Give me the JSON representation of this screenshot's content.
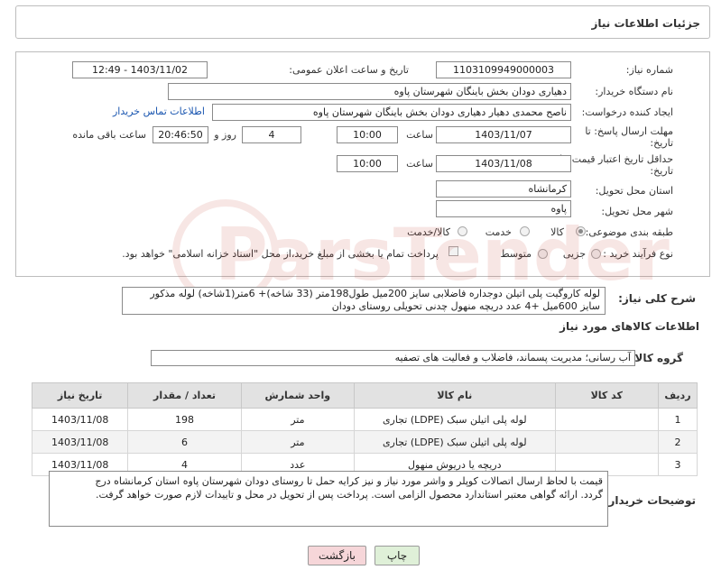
{
  "header": {
    "title": "جزئیات اطلاعات نیاز"
  },
  "form": {
    "need_number_label": "شماره نیاز:",
    "need_number": "1103109949000003",
    "announce_label": "تاریخ و ساعت اعلان عمومی:",
    "announce_value": "1403/11/02 - 12:49",
    "buyer_org_label": "نام دستگاه خریدار:",
    "buyer_org": "دهیاری دودان بخش باینگان شهرستان پاوه",
    "requester_label": "ایجاد کننده درخواست:",
    "requester": "ناصح محمدی دهیار دهیاری دودان بخش باینگان شهرستان پاوه",
    "contact_link": "اطلاعات تماس خریدار",
    "reply_deadline_label_1": "مهلت ارسال پاسخ: تا",
    "reply_deadline_label_2": "تاریخ:",
    "reply_date": "1403/11/07",
    "time_label": "ساعت",
    "reply_time": "10:00",
    "days_value": "4",
    "days_label": "روز و",
    "remaining_time": "20:46:50",
    "remaining_label": "ساعت باقی مانده",
    "price_validity_label_1": "حداقل تاریخ اعتبار قیمت: تا",
    "price_validity_label_2": "تاریخ:",
    "price_date": "1403/11/08",
    "price_time": "10:00",
    "province_label": "استان محل تحویل:",
    "province": "کرمانشاه",
    "city_label": "شهر محل تحویل:",
    "city": "پاوه",
    "category_label": "طبقه بندی موضوعی:",
    "category_options": [
      "کالا",
      "خدمت",
      "کالا/خدمت"
    ],
    "category_selected": 0,
    "process_label": "نوع فرآیند خرید :",
    "process_options": [
      "جزیی",
      "متوسط"
    ],
    "process_note": "پرداخت تمام یا بخشی از مبلغ خرید،از محل \"اسناد خزانه اسلامی\" خواهد بود."
  },
  "summary": {
    "label": "شرح کلی نیاز:",
    "text_line1": "لوله کاروگیت پلی اتیلن دوجداره فاضلابی سایز 200میل طول198متر (33 شاخه)+ 6متر(1شاخه) لوله مذکور",
    "text_line2": "سایز 600میل +4 عدد دریچه منهول چدنی تحویلی روستای دودان"
  },
  "goods": {
    "section_title": "اطلاعات کالاهای مورد نیاز",
    "group_label": "گروه کالا:",
    "group_value": "آب رسانی؛ مدیریت پسماند، فاضلاب و فعالیت های تصفیه",
    "columns": [
      "ردیف",
      "کد کالا",
      "نام کالا",
      "واحد شمارش",
      "تعداد / مقدار",
      "تاریخ نیاز"
    ],
    "rows": [
      {
        "row": "1",
        "code": "",
        "name": "لوله پلی اتیلن سبک (LDPE) تجاری",
        "unit": "متر",
        "qty": "198",
        "date": "1403/11/08"
      },
      {
        "row": "2",
        "code": "",
        "name": "لوله پلی اتیلن سبک (LDPE) تجاری",
        "unit": "متر",
        "qty": "6",
        "date": "1403/11/08"
      },
      {
        "row": "3",
        "code": "",
        "name": "دریچه یا دریوش منهول",
        "unit": "عدد",
        "qty": "4",
        "date": "1403/11/08"
      }
    ]
  },
  "buyer_notes": {
    "label": "توضیحات خریدار:",
    "line1": "قیمت با لحاظ ارسال اتصالات کوپلر و واشر مورد نیاز و نیز کرایه حمل تا روستای دودان شهرستان پاوه استان کرمانشاه درج",
    "line2": "گردد. ارائه گواهی معتبر استاندارد محصول الزامی است. پرداخت پس از تحویل در محل و تاییدات لازم صورت خواهد گرفت."
  },
  "buttons": {
    "print": "چاپ",
    "back": "بازگشت"
  },
  "colors": {
    "link": "#1a56b0",
    "back_btn": "#f6d6d9",
    "print_btn": "#dff0d8"
  }
}
